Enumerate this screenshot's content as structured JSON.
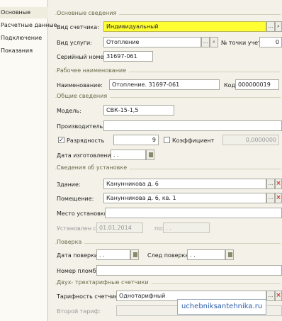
{
  "nav": {
    "items": [
      {
        "label": "Основные"
      },
      {
        "label": "Расчетные данные"
      },
      {
        "label": "Подключение"
      },
      {
        "label": "Показания"
      }
    ]
  },
  "sections": {
    "basic": "Основные сведения",
    "work_name": "Рабочее наименование",
    "general": "Общие сведения",
    "install": "Сведения об установке",
    "check": "Поверка",
    "tariff": "Двух- трехтарифные счетчики"
  },
  "fields": {
    "meter_type": {
      "label": "Вид счетчика:",
      "value": "Индивидуальный"
    },
    "service_type": {
      "label": "Вид услуги:",
      "value": "Отопление"
    },
    "point_no": {
      "label": "№ точки учета:",
      "value": "0"
    },
    "serial": {
      "label": "Серийный номер:",
      "value": "31697-061"
    },
    "name": {
      "label": "Наименование:",
      "value": "Отопление. 31697-061"
    },
    "code": {
      "label": "Код:",
      "value": "000000019"
    },
    "model": {
      "label": "Модель:",
      "value": "СВК-15-1,5"
    },
    "maker": {
      "label": "Производитель:",
      "value": ""
    },
    "digits": {
      "label": "Разрядность",
      "value": "9",
      "checked": true
    },
    "coef": {
      "label": "Коэффициент",
      "value": "0,0000000",
      "checked": false
    },
    "made_date": {
      "label": "Дата изготовления:",
      "value": ". ."
    },
    "building": {
      "label": "Здание:",
      "value": "Канунникова д. 6"
    },
    "room": {
      "label": "Помещение:",
      "value": "Канунникова д. 6, кв. 1"
    },
    "place": {
      "label": "Место установки:",
      "value": ""
    },
    "installed": {
      "label": "Установлен с:",
      "value": "01.01.2014",
      "to_label": "по:",
      "to_value": ". ."
    },
    "check_date": {
      "label": "Дата поверки:",
      "value": ". ."
    },
    "next_check": {
      "label": "След поверка:",
      "value": ". ."
    },
    "seal": {
      "label": "Номер пломбы:",
      "value": ""
    },
    "tariff_type": {
      "label": "Тарифность счетчика:",
      "value": "Однотарифный"
    },
    "second_tariff": {
      "label": "Второй тариф:",
      "value": ""
    }
  },
  "icons": {
    "select": "ellipsis-icon",
    "clear": "x-icon",
    "search": "magnifier-icon",
    "calendar": "calendar-icon"
  },
  "watermark": "uchebniksantehnika.ru",
  "colors": {
    "highlight": "#ffff33",
    "watermark": "#2a5daa"
  }
}
